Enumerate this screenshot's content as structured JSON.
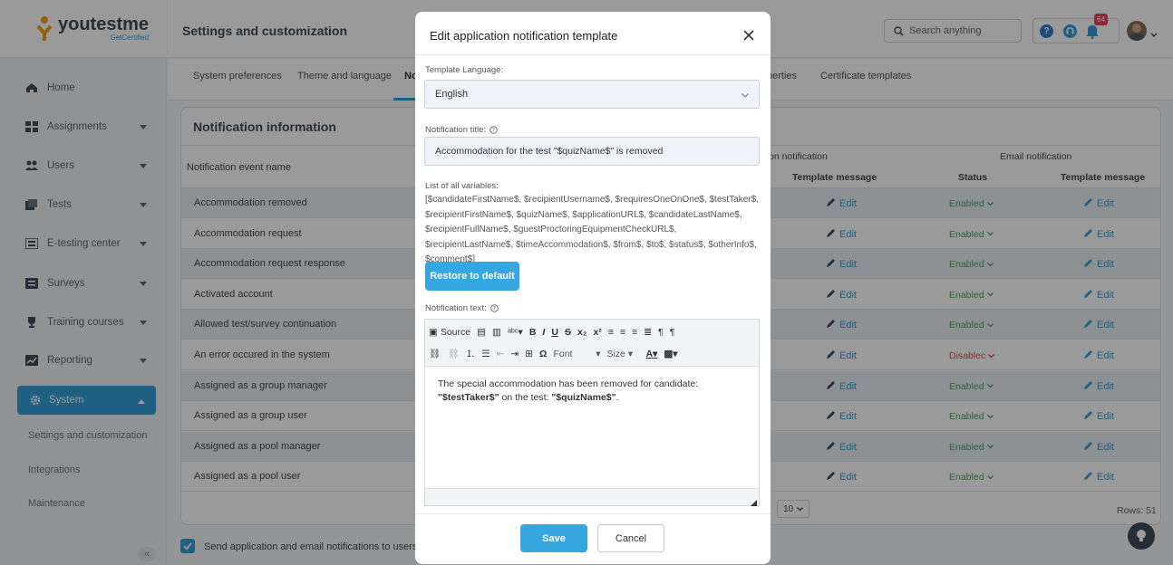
{
  "brand": {
    "name": "youtestme",
    "tagline": "GetCertified",
    "accent": "#1e94d4",
    "orange": "#f39200"
  },
  "sidebar": {
    "items": [
      {
        "label": "Home",
        "icon": "home-icon"
      },
      {
        "label": "Assignments",
        "icon": "assignments-icon"
      },
      {
        "label": "Users",
        "icon": "users-icon"
      },
      {
        "label": "Tests",
        "icon": "tests-icon"
      },
      {
        "label": "E-testing center",
        "icon": "etesting-icon"
      },
      {
        "label": "Surveys",
        "icon": "surveys-icon"
      },
      {
        "label": "Training courses",
        "icon": "trophy-icon"
      },
      {
        "label": "Reporting",
        "icon": "reporting-icon"
      }
    ],
    "active": {
      "label": "System",
      "icon": "gear-icon"
    },
    "sub_items": [
      "Settings and customization",
      "Integrations",
      "Maintenance"
    ],
    "collapse_icon": "double-chevron-left-icon"
  },
  "header": {
    "title": "Settings and customization",
    "search_placeholder": "Search anything",
    "notification_count": "64"
  },
  "tabs": [
    "System preferences",
    "Theme and language",
    "No",
    "perties",
    "Certificate templates"
  ],
  "card": {
    "title": "Notification information",
    "col_event": "Notification event name",
    "group_app": "on notification",
    "group_email": "Email notification",
    "col_template": "Template message",
    "col_status": "Status",
    "col_template2": "Template message",
    "edit_label": "Edit",
    "rows": [
      {
        "name": "Accommodation removed",
        "status": "Enabled"
      },
      {
        "name": "Accommodation request",
        "status": "Enabled"
      },
      {
        "name": "Accommodation request response",
        "status": "Enabled"
      },
      {
        "name": "Activated account",
        "status": "Enabled"
      },
      {
        "name": "Allowed test/survey continuation",
        "status": "Enabled"
      },
      {
        "name": "An error occured in the system",
        "status": "Disablec"
      },
      {
        "name": "Assigned as a group manager",
        "status": "Enabled"
      },
      {
        "name": "Assigned as a group user",
        "status": "Enabled"
      },
      {
        "name": "Assigned as a pool manager",
        "status": "Enabled"
      },
      {
        "name": "Assigned as a pool user",
        "status": "Enabled"
      }
    ],
    "page_size": "10",
    "rows_label": "Rows: 51"
  },
  "footer": {
    "checkbox_label": "Send application and email notifications to users upon"
  },
  "modal": {
    "title": "Edit application notification template",
    "language_label": "Template Language:",
    "language_value": "English",
    "title_label": "Notification title:",
    "title_value": "Accommodation for the test \"$quizName$\" is removed",
    "variables_label": "List of all variables:",
    "variables_text": "[$candidateFirstName$, $recipientUsername$, $requiresOneOnOne$, $testTaker$, $recipientFirstName$, $quizName$, $applicationURL$, $candidateLastName$, $recipientFullName$, $guestProctoringEquipmentCheckURL$, $recipientLastName$, $timeAccommodation$, $from$, $to$, $status$, $otherInfo$, $comment$]",
    "restore_label": "Restore to default",
    "text_label": "Notification text:",
    "toolbar": {
      "source": "Source",
      "font": "Font",
      "size": "Size"
    },
    "body_pre": "The special accommodation has been removed for candidate: ",
    "body_var1": "\"$testTaker$\"",
    "body_mid": " on the test: ",
    "body_var2": "\"$quizName$\"",
    "body_end": ".",
    "save_label": "Save",
    "cancel_label": "Cancel"
  }
}
